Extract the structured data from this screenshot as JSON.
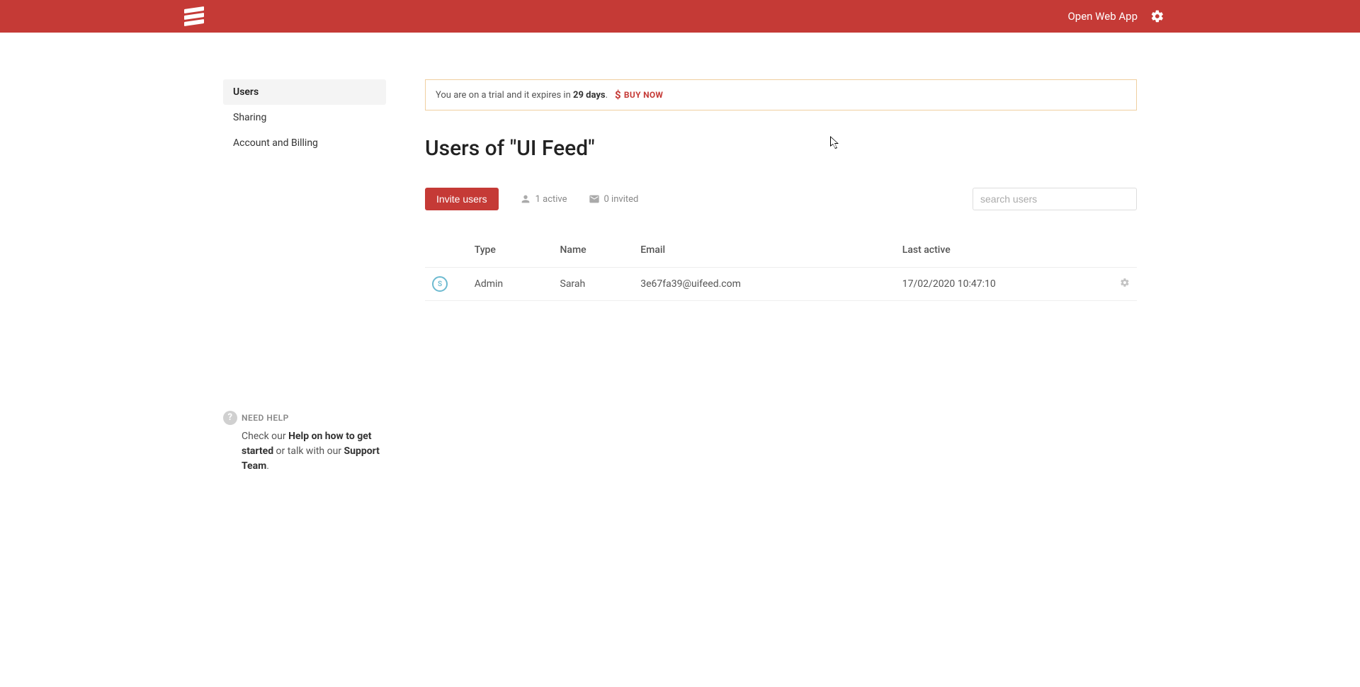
{
  "header": {
    "open_web_app": "Open Web App"
  },
  "sidebar": {
    "items": [
      {
        "label": "Users"
      },
      {
        "label": "Sharing"
      },
      {
        "label": "Account and Billing"
      }
    ]
  },
  "help": {
    "title": "NEED HELP",
    "check_our": "Check our ",
    "help_link": "Help on how to get started",
    "or_talk": " or talk with our ",
    "support_link": "Support Team",
    "period": "."
  },
  "trial": {
    "prefix": "You are on a trial and it expires in ",
    "days_value": "29 days",
    "suffix": ".",
    "buy_now": "BUY NOW",
    "dollar": "$"
  },
  "page": {
    "title": "Users of \"UI Feed\""
  },
  "toolbar": {
    "invite_label": "Invite users",
    "active_count": "1 active",
    "invited_count": "0 invited",
    "search_placeholder": "search users"
  },
  "table": {
    "headers": {
      "type": "Type",
      "name": "Name",
      "email": "Email",
      "last_active": "Last active"
    },
    "rows": [
      {
        "avatar_initial": "S",
        "type": "Admin",
        "name": "Sarah",
        "email": "3e67fa39@uifeed.com",
        "last_active": "17/02/2020 10:47:10"
      }
    ]
  }
}
